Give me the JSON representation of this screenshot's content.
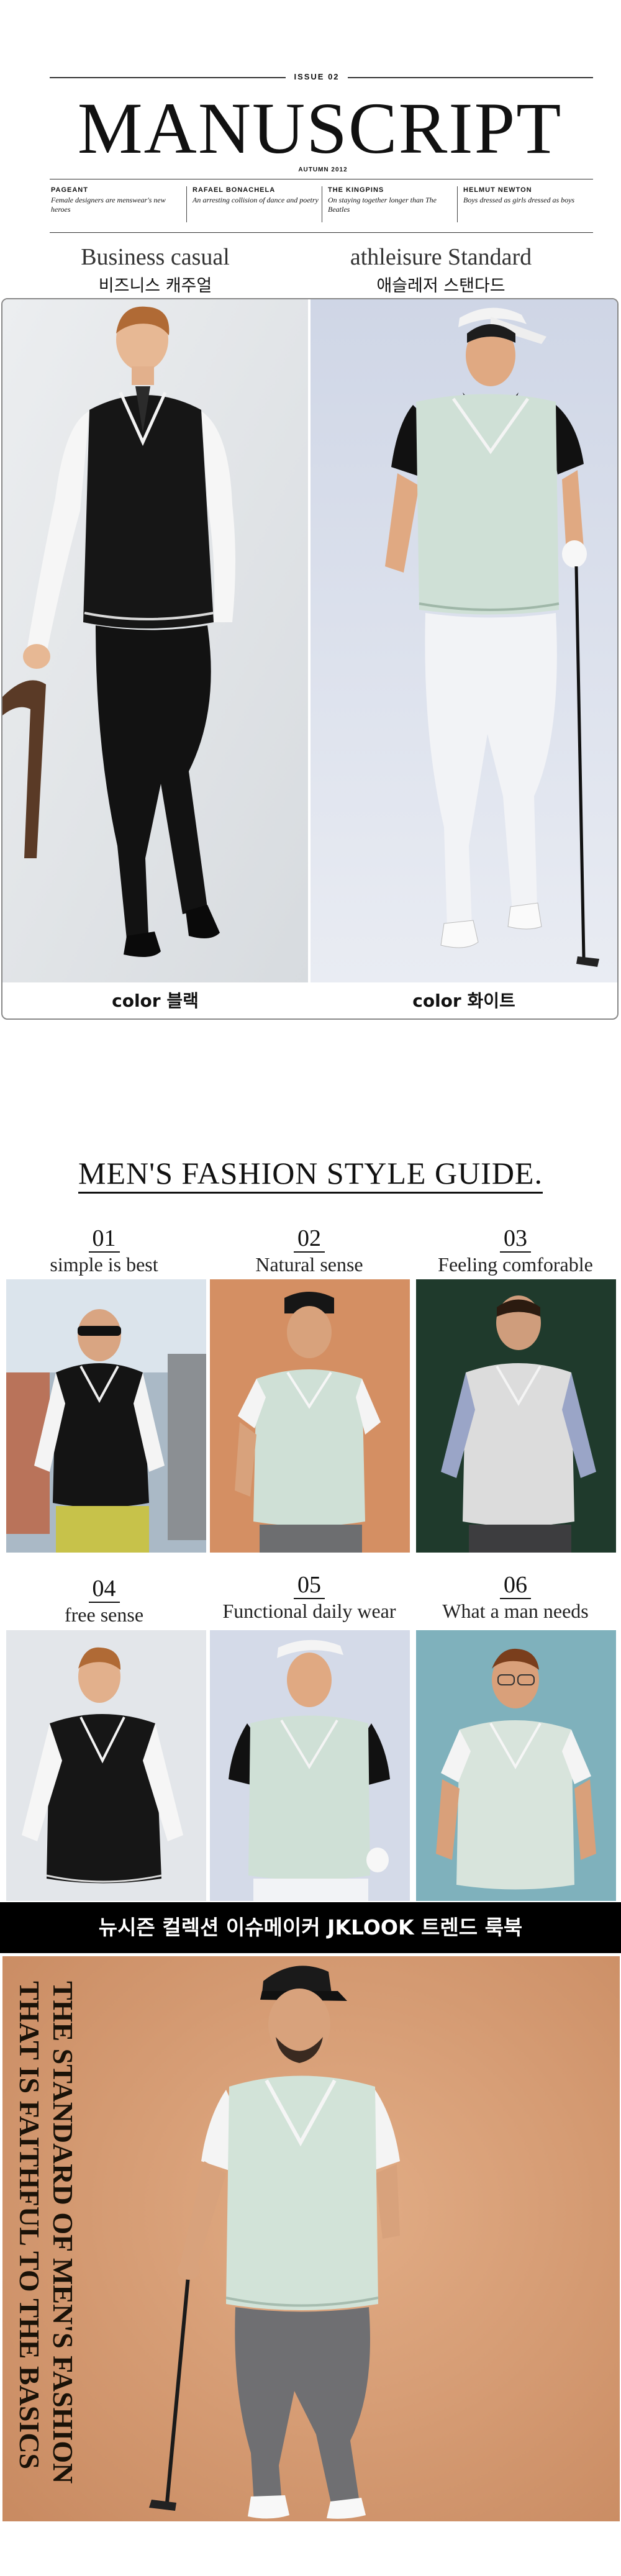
{
  "masthead": {
    "issue": "ISSUE 02",
    "title": "MANUSCRIPT",
    "season": "AUTUMN 2012",
    "columns": [
      {
        "heading": "PAGEANT",
        "sub": "Female designers are menswear's new heroes"
      },
      {
        "heading": "RAFAEL BONACHELA",
        "sub": "An arresting collision of dance and poetry"
      },
      {
        "heading": "THE KINGPINS",
        "sub": "On staying together longer than The Beatles"
      },
      {
        "heading": "HELMUT NEWTON",
        "sub": "Boys dressed as girls dressed as boys"
      }
    ]
  },
  "hero": {
    "left": {
      "title": "Business casual",
      "korean": "비즈니스 캐주얼",
      "color_label": "color 블랙"
    },
    "right": {
      "title": "athleisure Standard",
      "korean": "애슬레저 스탠다드",
      "color_label": "color 화이트"
    }
  },
  "guide": {
    "title": "MEN'S FASHION STYLE GUIDE.",
    "items": [
      {
        "number": "01",
        "caption": "simple is best"
      },
      {
        "number": "02",
        "caption": "Natural sense"
      },
      {
        "number": "03",
        "caption": "Feeling comforable"
      },
      {
        "number": "04",
        "caption": "free sense"
      },
      {
        "number": "05",
        "caption": "Functional daily wear"
      },
      {
        "number": "06",
        "caption": "What a man needs"
      }
    ]
  },
  "banner": {
    "text": "뉴시즌 컬렉션 이슈메이커  JKLOOK 트렌드 룩북"
  },
  "final": {
    "lines": [
      "THE STANDARD OF MEN'S FASHION",
      "THAT IS FAITHFUL TO THE BASICS"
    ]
  },
  "colors": {
    "accent_tan": "#d8a077",
    "banner_bg": "#000000",
    "vest_mint": "#cfe0d6",
    "vest_black": "#141414"
  }
}
